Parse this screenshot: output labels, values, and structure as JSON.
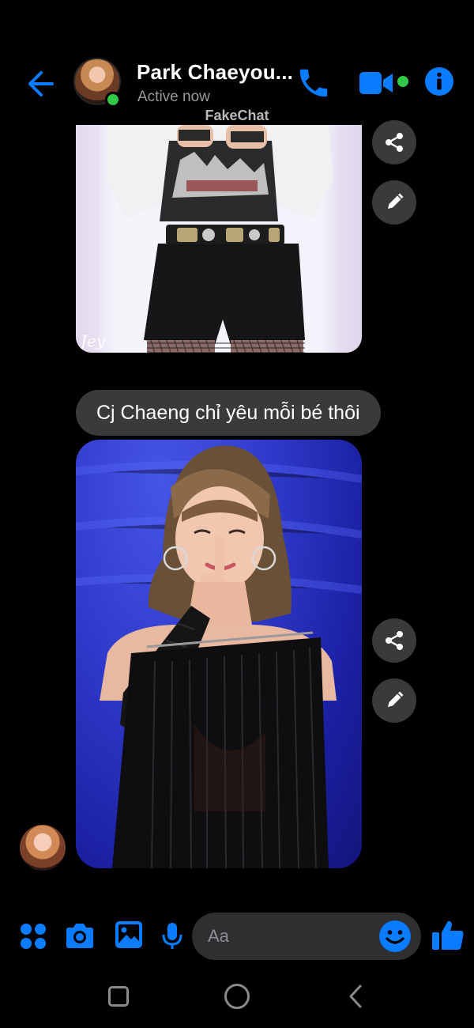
{
  "header": {
    "contact_name": "Park Chaeyou...",
    "status": "Active now"
  },
  "watermark": "FakeChat",
  "messages": {
    "text": "Cj Chaeng chỉ yêu mỗi bé thôi",
    "photo1_signature": "Jey"
  },
  "composer": {
    "placeholder": "Aa"
  },
  "colors": {
    "accent": "#0a7cff",
    "online": "#31c948",
    "bubble": "#3a3a3c",
    "background": "#000000"
  },
  "icons": {
    "back": "arrow-left-icon",
    "call": "phone-icon",
    "video": "video-camera-icon",
    "info": "info-icon",
    "share": "share-icon",
    "edit": "pencil-icon",
    "apps": "apps-grid-icon",
    "camera": "camera-icon",
    "gallery": "image-icon",
    "mic": "microphone-icon",
    "emoji": "emoji-icon",
    "like": "thumbs-up-icon"
  }
}
